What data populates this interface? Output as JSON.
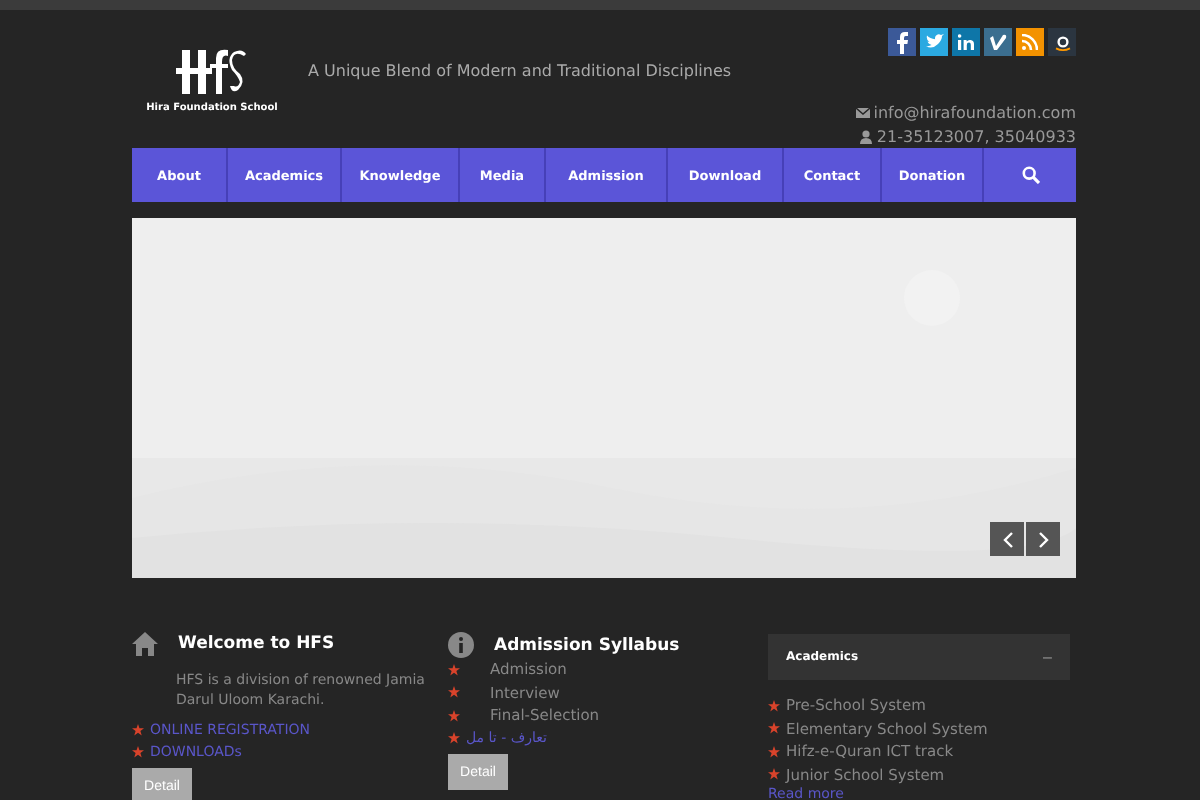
{
  "header": {
    "logo_text": "Hira Foundation School",
    "tagline": "A Unique Blend of Modern and Traditional Disciplines",
    "social": [
      {
        "kind": "facebook",
        "color": "#3b5998"
      },
      {
        "kind": "twitter",
        "color": "#2ba9e1"
      },
      {
        "kind": "linkedin",
        "color": "#0e76a8"
      },
      {
        "kind": "vimeo",
        "color": "#3b6e8f"
      },
      {
        "kind": "rss",
        "color": "#f39200"
      },
      {
        "kind": "amazon",
        "color": "#2b3540"
      }
    ],
    "email": "info@hirafoundation.com",
    "phone": "21-35123007, 35040933"
  },
  "nav": {
    "items": [
      "About",
      "Academics",
      "Knowledge",
      "Media",
      "Admission",
      "Download",
      "Contact",
      "Donation"
    ]
  },
  "welcome": {
    "title": "Welcome to HFS",
    "text": "HFS is a division of renowned Jamia Darul Uloom Karachi.",
    "links": [
      "ONLINE REGISTRATION",
      "DOWNLOADs"
    ],
    "button": "Detail"
  },
  "syllabus": {
    "title": "Admission Syllabus",
    "items": [
      {
        "text": "Admission",
        "link": false
      },
      {
        "text": "Interview",
        "link": false
      },
      {
        "text": "Final-Selection",
        "link": false
      },
      {
        "text": "تعارف - تا مل",
        "link": true
      }
    ],
    "button": "Detail"
  },
  "academics": {
    "title": "Academics",
    "toggle": "–",
    "expanded": true,
    "items": [
      "Pre-School System",
      "Elementary School System",
      "Hifz-e-Quran ICT track",
      "Junior School System"
    ],
    "more": "Read more"
  }
}
